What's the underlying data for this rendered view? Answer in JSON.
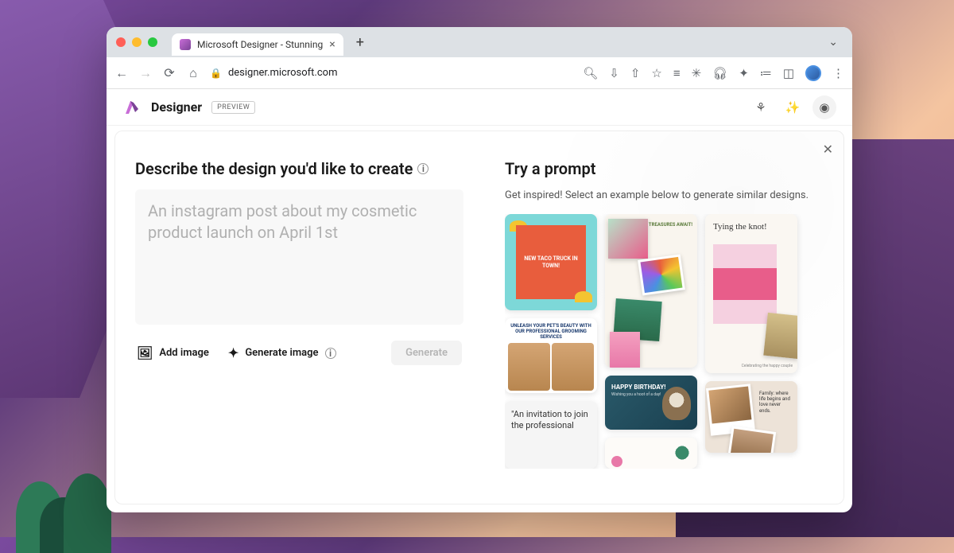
{
  "browser": {
    "tab_title": "Microsoft Designer - Stunning",
    "url": "designer.microsoft.com"
  },
  "app": {
    "title": "Designer",
    "badge": "PREVIEW"
  },
  "left": {
    "heading": "Describe the design you'd like to create",
    "placeholder": "An instagram post about my cosmetic product launch on April 1st",
    "add_image": "Add image",
    "generate_image": "Generate image",
    "generate": "Generate"
  },
  "right": {
    "heading": "Try a prompt",
    "subtext": "Get inspired! Select an example below to generate similar designs."
  },
  "cards": {
    "taco": "NEW TACO TRUCK IN TOWN!",
    "pets_line1": "UNLEASH YOUR PET'S BEAUTY WITH OUR PROFESSIONAL GROOMING SERVICES",
    "invite": "\"An invitation to join the professional",
    "treasures": "HANDMADE TREASURES AWAIT!",
    "bday_t1": "HAPPY BIRTHDAY!",
    "bday_t2": "Wishing you a hoot of a day!",
    "knot_title": "Tying the knot!",
    "knot_cap": "Celebrating the happy couple",
    "family": "Family: where life begins and love never ends."
  }
}
